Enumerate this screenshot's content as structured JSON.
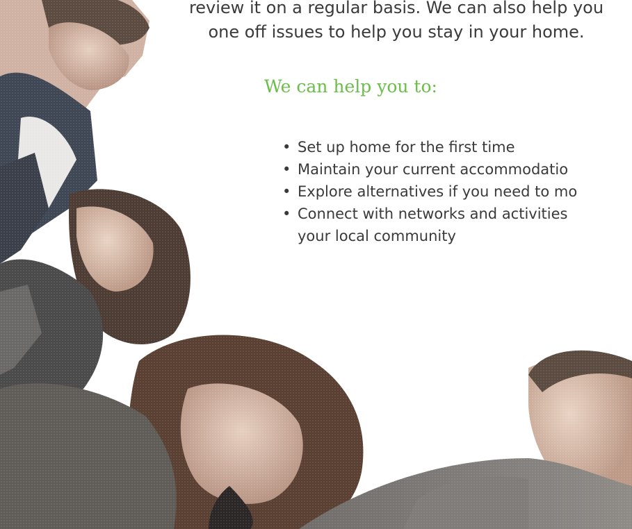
{
  "intro": {
    "line1": "review it on a regular basis. We can also help you",
    "line2": "one off issues to help you stay in your home."
  },
  "help": {
    "heading": "We can help you to:",
    "items": [
      {
        "text": "Set up home for the first time"
      },
      {
        "text": "Maintain your current accommodatio"
      },
      {
        "text": "Explore alternatives if you need to mo"
      },
      {
        "text": "Connect with networks and activities",
        "continuation": "your local community"
      }
    ]
  },
  "colors": {
    "heading_green": "#6bbd4a",
    "body_text": "#3a3a3a"
  }
}
